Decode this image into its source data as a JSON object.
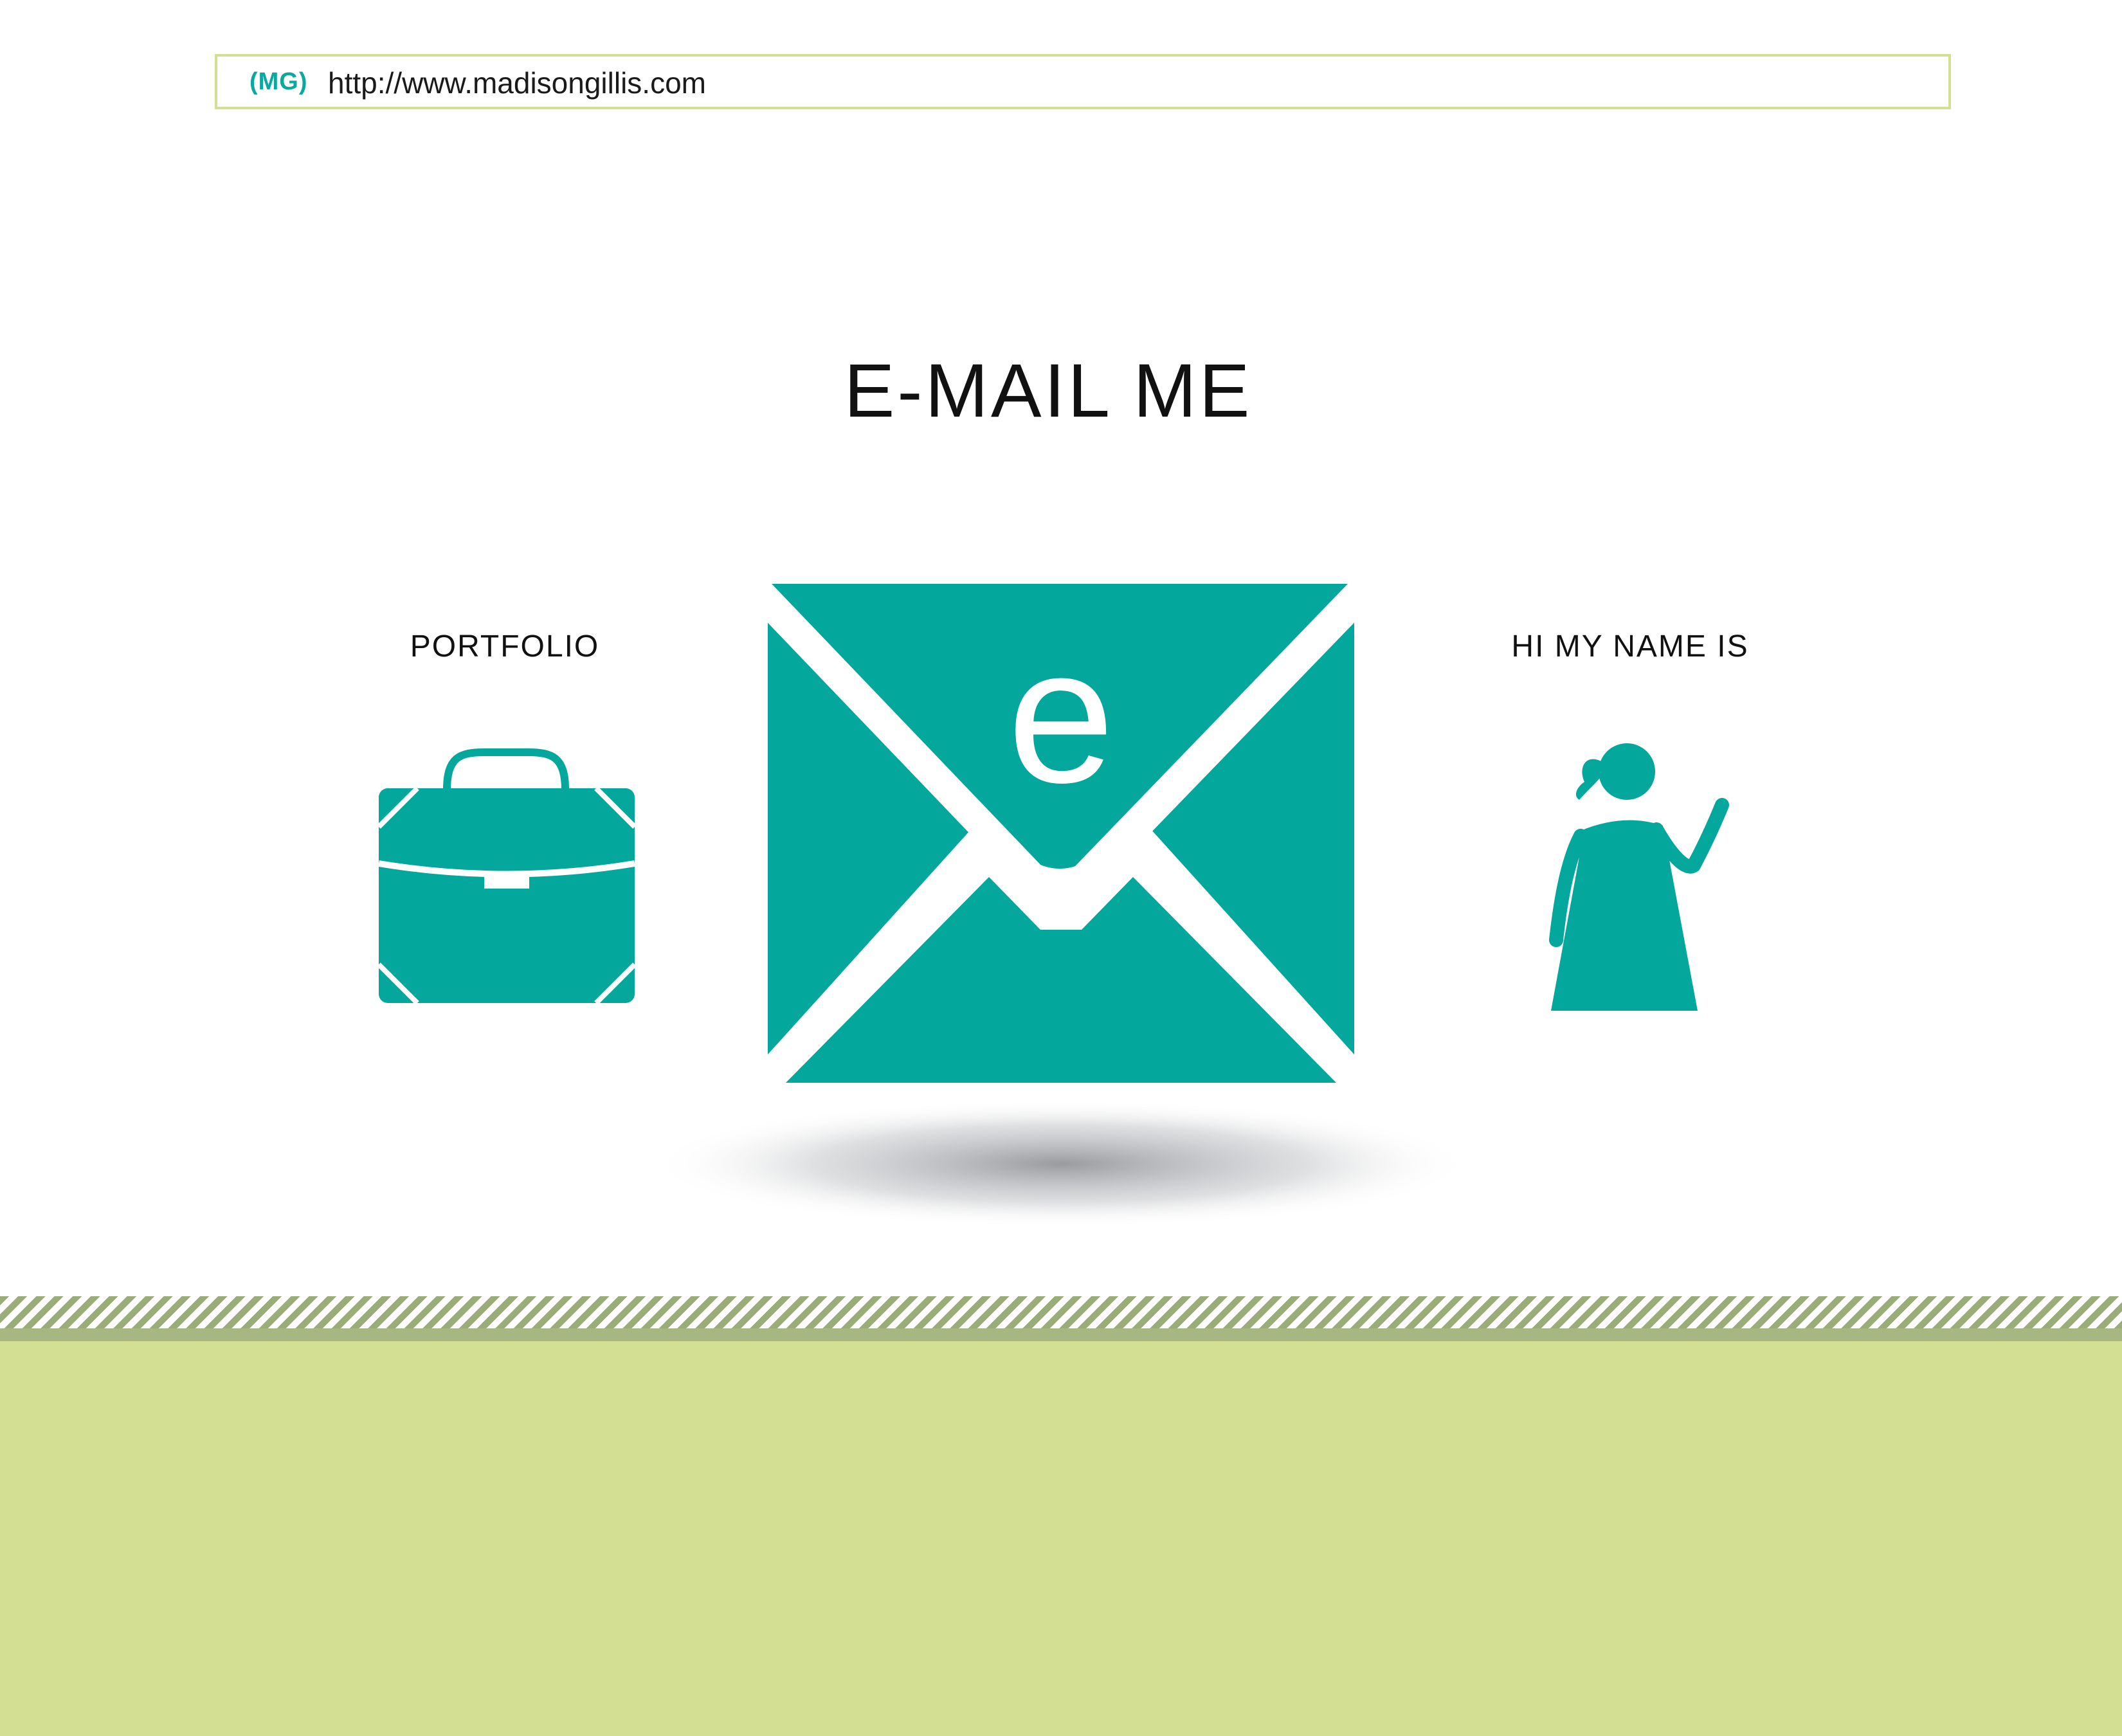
{
  "urlbar": {
    "badge": "(MG)",
    "url": "http://www.madisongillis.com"
  },
  "page": {
    "title": "E-MAIL ME"
  },
  "nav": {
    "portfolio_label": "PORTFOLIO",
    "about_label": "HI MY NAME IS"
  },
  "envelope": {
    "letter": "e"
  },
  "colors": {
    "accent": "#03a79c",
    "border": "#d3df92",
    "footer": "#d3df92",
    "stripe": "#9aac77"
  },
  "icons": {
    "portfolio": "briefcase-icon",
    "email": "envelope-icon",
    "about": "person-waving-icon"
  }
}
